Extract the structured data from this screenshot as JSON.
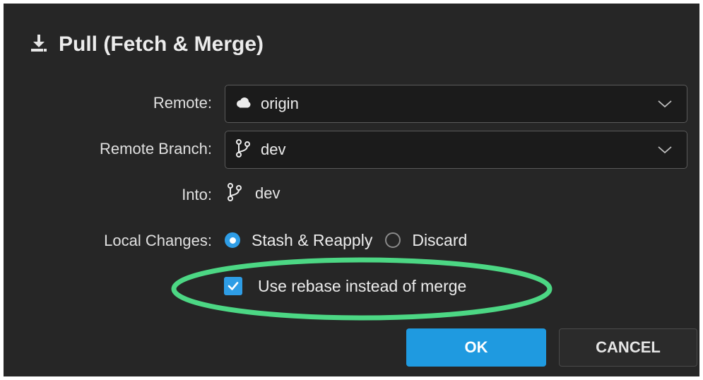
{
  "dialog": {
    "title": "Pull (Fetch & Merge)",
    "title_icon": "download-icon"
  },
  "remote": {
    "label": "Remote:",
    "value": "origin",
    "icon": "cloud-icon"
  },
  "remote_branch": {
    "label": "Remote Branch:",
    "value": "dev",
    "icon": "branch-icon"
  },
  "into": {
    "label": "Into:",
    "value": "dev",
    "icon": "branch-icon"
  },
  "local_changes": {
    "label": "Local Changes:",
    "options": [
      {
        "label": "Stash & Reapply",
        "selected": true
      },
      {
        "label": "Discard",
        "selected": false
      }
    ]
  },
  "rebase": {
    "label": "Use rebase instead of merge",
    "checked": true
  },
  "buttons": {
    "ok": "OK",
    "cancel": "CANCEL"
  },
  "colors": {
    "accent": "#1f9ae0",
    "highlight": "#4cd784",
    "background": "#262626"
  }
}
